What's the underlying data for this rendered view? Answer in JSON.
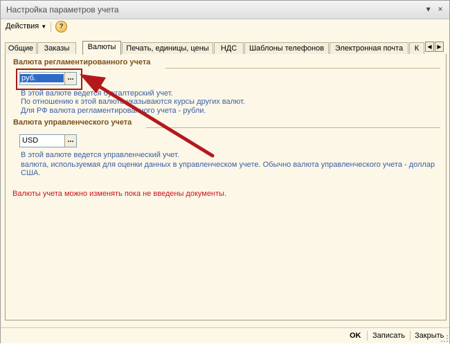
{
  "window": {
    "title": "Настройка параметров учета",
    "btn_menu": "▾",
    "btn_close": "×"
  },
  "toolbar": {
    "actions_label": "Действия",
    "help_label": "?"
  },
  "tabs": [
    {
      "label": "Общие"
    },
    {
      "label": "Заказы"
    },
    {
      "label": "Валюты"
    },
    {
      "label": "Печать, единицы, цены"
    },
    {
      "label": "НДС"
    },
    {
      "label": "Шаблоны телефонов"
    },
    {
      "label": "Электронная почта"
    },
    {
      "label": "К"
    }
  ],
  "reg_currency": {
    "group_title": "Валюта регламентированного учета",
    "value": "руб.",
    "hint_1": "В этой валюте ведется бухгалтерский учет.",
    "hint_2": "По отношению к этой валюте указываются курсы других валют.",
    "hint_3": "Для РФ валюта регламентированного учета - рубли."
  },
  "mgmt_currency": {
    "group_title": "Валюта управленческого учета",
    "value": "USD",
    "hint_1": "В этой валюте ведется управленческий учет.",
    "hint_2": "валюта, используемая для оценки данных в управленческом учете. Обычно валюта управленческого учета - доллар США."
  },
  "warning": "Валюты учета можно изменять пока не введены документы.",
  "footer": {
    "ok": "OK",
    "save": "Записать",
    "close": "Закрыть"
  },
  "colors": {
    "annotation": "#b3191c",
    "hint": "#3a5ea8",
    "group_title": "#7c4f1a",
    "warning": "#c8141b"
  }
}
